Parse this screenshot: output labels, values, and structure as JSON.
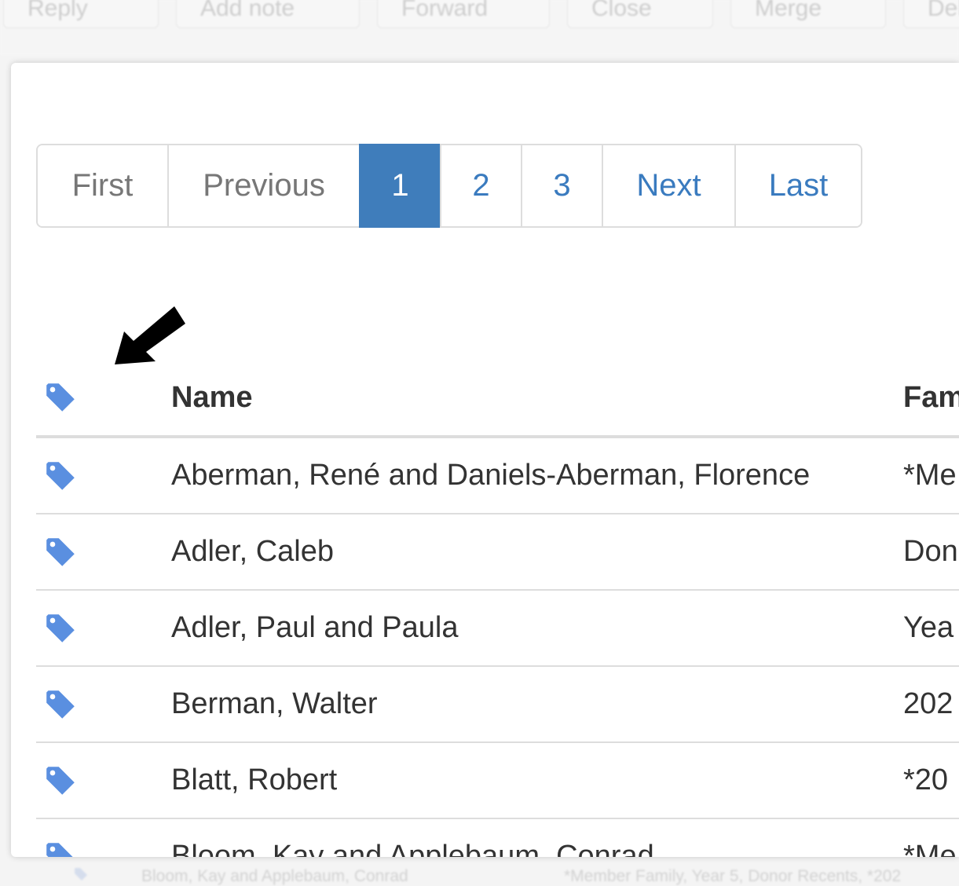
{
  "toolbar": {
    "buttons": [
      "Reply",
      "Add note",
      "Forward",
      "Close",
      "Merge",
      "Delete"
    ]
  },
  "pagination": {
    "first": "First",
    "previous": "Previous",
    "pages": [
      "1",
      "2",
      "3"
    ],
    "active_page": "1",
    "next": "Next",
    "last": "Last"
  },
  "table": {
    "columns": [
      "",
      "Name",
      "Fam"
    ],
    "rows": [
      {
        "name": "Aberman, René and Daniels-Aberman, Florence",
        "family": "*Me"
      },
      {
        "name": "Adler, Caleb",
        "family": "Don"
      },
      {
        "name": "Adler, Paul and Paula",
        "family": "Yea"
      },
      {
        "name": "Berman, Walter",
        "family": "202"
      },
      {
        "name": "Blatt, Robert",
        "family": "*20"
      },
      {
        "name": "Bloom, Kay and Applebaum, Conrad",
        "family": "*Me"
      }
    ]
  },
  "background_row": {
    "name": "Bloom, Kay and Applebaum, Conrad",
    "family": "*Member Family, Year 5, Donor Recents, *202"
  },
  "colors": {
    "tag_icon": "#5a8fe0",
    "active_page_bg": "#3f7dbb",
    "link": "#3a7bbf"
  },
  "icons": {
    "tag": "tag-icon",
    "pointer": "arrow-pointer-icon"
  }
}
